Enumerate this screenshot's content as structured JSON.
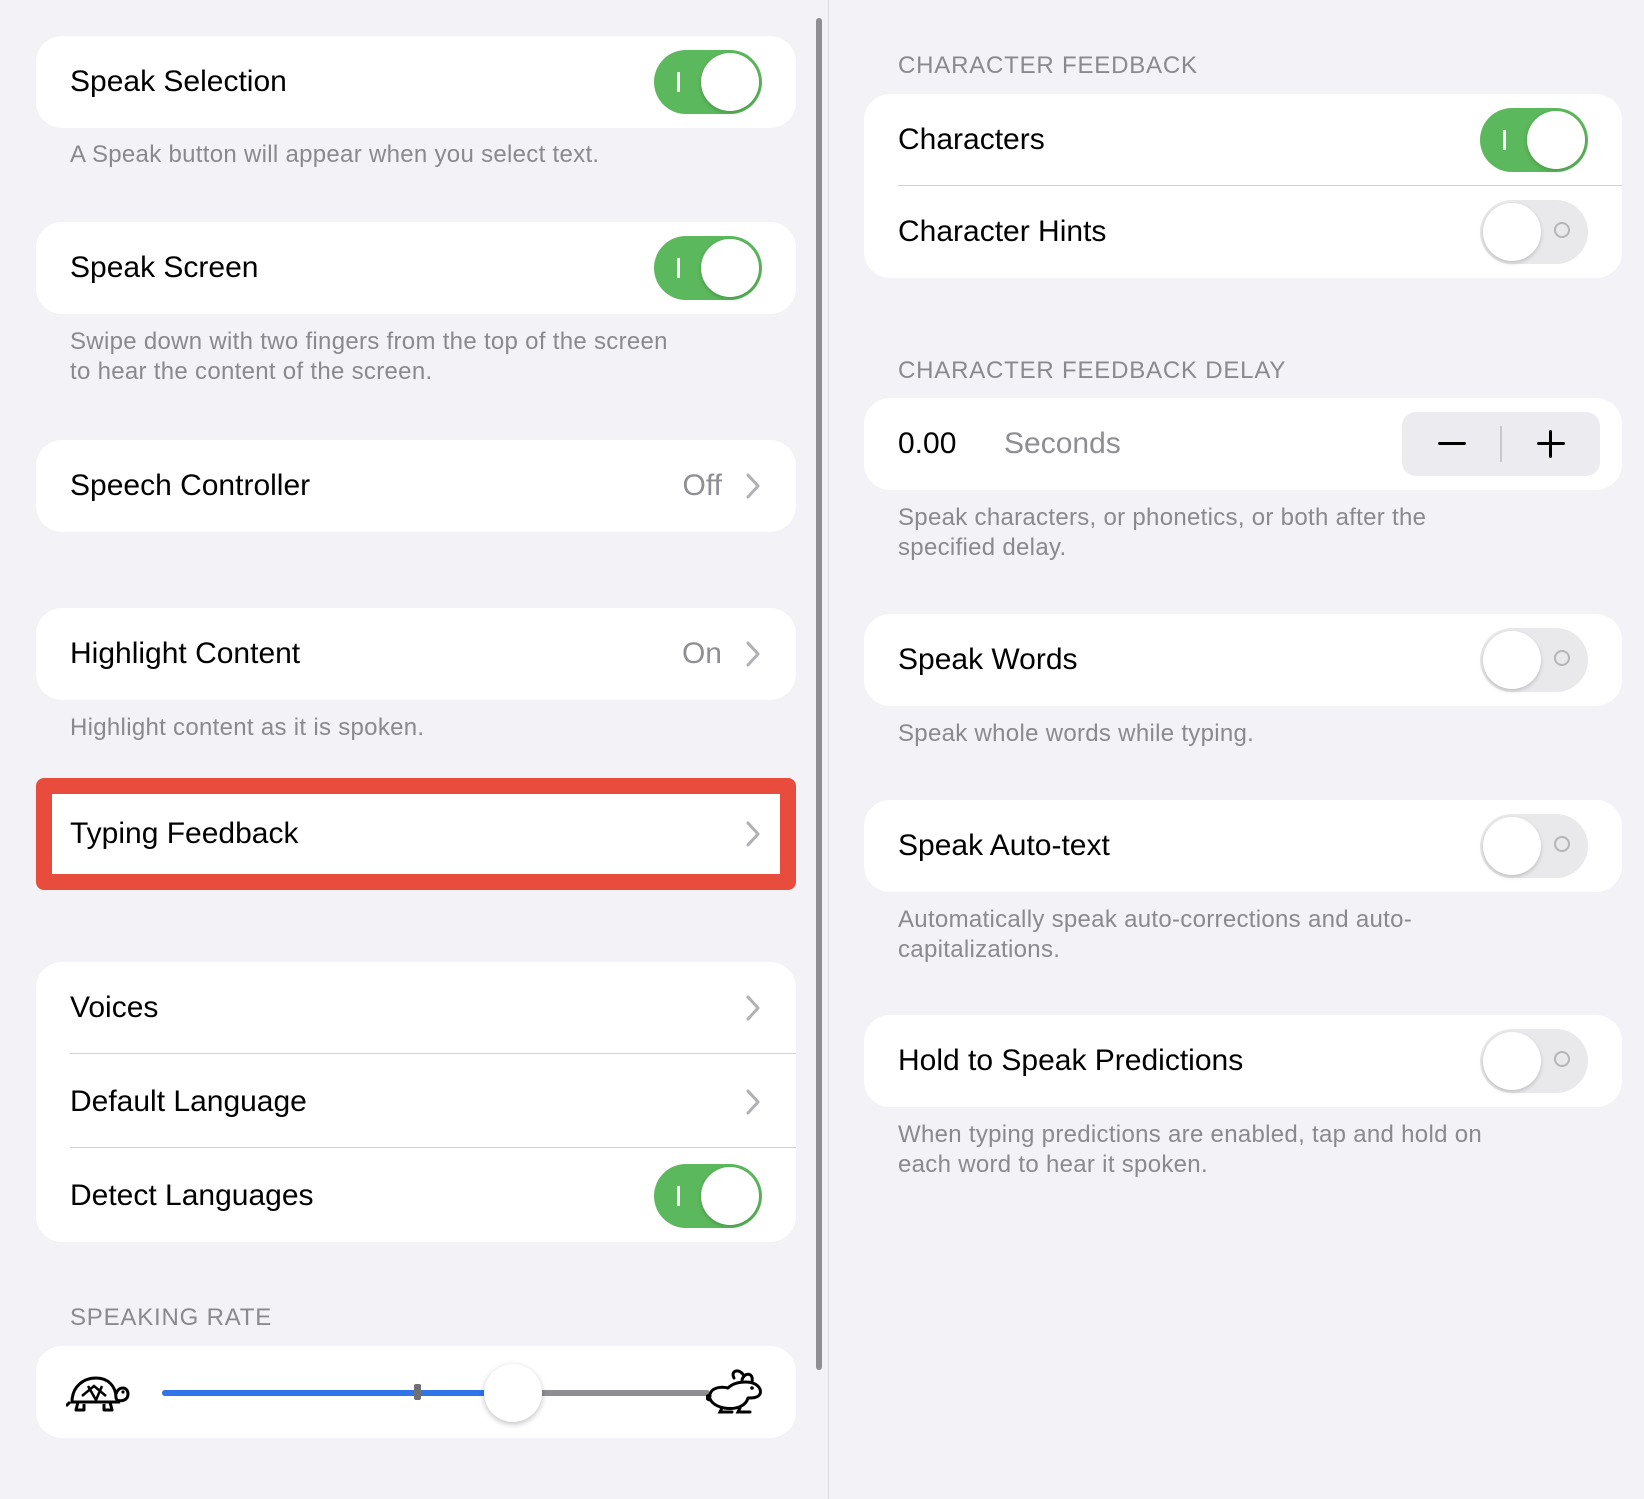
{
  "left": {
    "speak_selection": {
      "label": "Speak Selection",
      "on": true,
      "footer": "A Speak button will appear when you select text."
    },
    "speak_screen": {
      "label": "Speak Screen",
      "on": true,
      "footer_lines": [
        "Swipe down with two fingers from the top of the screen",
        "to hear the content of the screen."
      ]
    },
    "speech_controller": {
      "label": "Speech Controller",
      "value": "Off"
    },
    "highlight_content": {
      "label": "Highlight Content",
      "value": "On",
      "footer": "Highlight content as it is spoken."
    },
    "typing_feedback": {
      "label": "Typing Feedback"
    },
    "voices": {
      "label": "Voices"
    },
    "default_language": {
      "label": "Default Language"
    },
    "detect_languages": {
      "label": "Detect Languages",
      "on": true
    },
    "speaking_rate": {
      "header": "SPEAKING RATE",
      "level": 0.64,
      "slow_icon": "turtle-icon",
      "fast_icon": "rabbit-icon"
    }
  },
  "right": {
    "character_feedback": {
      "header": "CHARACTER FEEDBACK",
      "characters": {
        "label": "Characters",
        "on": true
      },
      "character_hints": {
        "label": "Character Hints",
        "on": false
      }
    },
    "character_feedback_delay": {
      "header": "CHARACTER FEEDBACK DELAY",
      "value": "0.00",
      "unit": "Seconds",
      "footer_lines": [
        "Speak characters, or phonetics, or both after the",
        "specified delay."
      ]
    },
    "speak_words": {
      "label": "Speak Words",
      "on": false,
      "footer": "Speak whole words while typing."
    },
    "speak_auto_text": {
      "label": "Speak Auto-text",
      "on": false,
      "footer_lines": [
        "Automatically speak auto-corrections and auto-",
        "capitalizations."
      ]
    },
    "hold_to_speak": {
      "label": "Hold to Speak Predictions",
      "on": false,
      "footer_lines": [
        "When typing predictions are enabled, tap and hold on",
        "each word to hear it spoken."
      ]
    }
  },
  "colors": {
    "toggle_on": "#5cb85c",
    "highlight_border": "#e84c3d",
    "slider_fill": "#2f74e8",
    "background": "#f2f2f7"
  }
}
